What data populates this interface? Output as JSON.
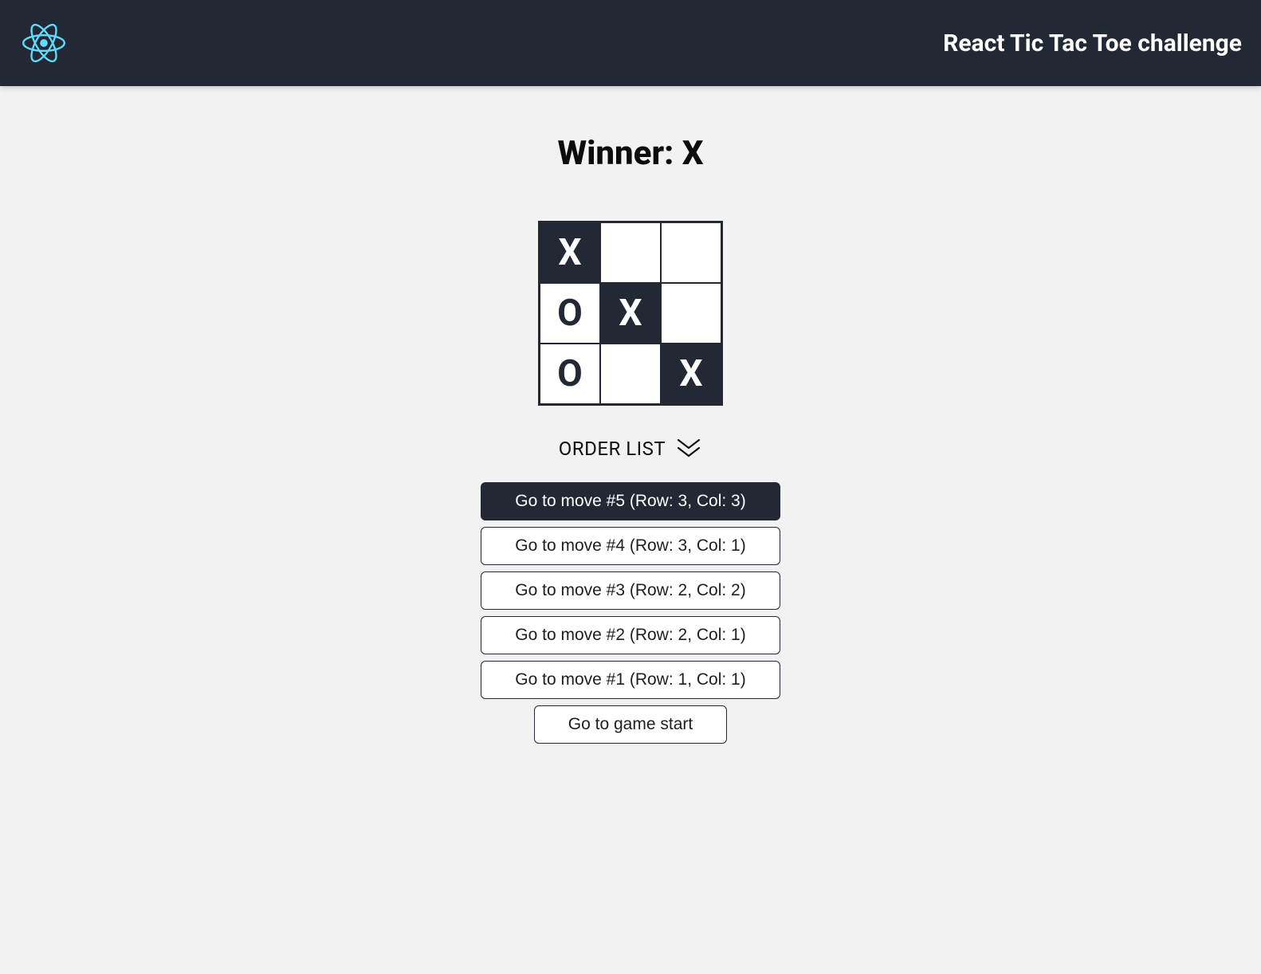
{
  "header": {
    "title": "React Tic Tac Toe challenge"
  },
  "game": {
    "status": "Winner: X",
    "board": [
      {
        "value": "X",
        "highlight": true
      },
      {
        "value": "",
        "highlight": false
      },
      {
        "value": "",
        "highlight": false
      },
      {
        "value": "O",
        "highlight": false
      },
      {
        "value": "X",
        "highlight": true
      },
      {
        "value": "",
        "highlight": false
      },
      {
        "value": "O",
        "highlight": false
      },
      {
        "value": "",
        "highlight": false
      },
      {
        "value": "X",
        "highlight": true
      }
    ]
  },
  "order": {
    "label": "ORDER LIST"
  },
  "moves": [
    {
      "label": "Go to move #5 (Row: 3, Col: 3)",
      "current": true,
      "start": false
    },
    {
      "label": "Go to move #4 (Row: 3, Col: 1)",
      "current": false,
      "start": false
    },
    {
      "label": "Go to move #3 (Row: 2, Col: 2)",
      "current": false,
      "start": false
    },
    {
      "label": "Go to move #2 (Row: 2, Col: 1)",
      "current": false,
      "start": false
    },
    {
      "label": "Go to move #1 (Row: 1, Col: 1)",
      "current": false,
      "start": false
    },
    {
      "label": "Go to game start",
      "current": false,
      "start": true
    }
  ],
  "colors": {
    "header_bg": "#222834",
    "page_bg": "#f2f2f2",
    "accent": "#61dafb"
  }
}
